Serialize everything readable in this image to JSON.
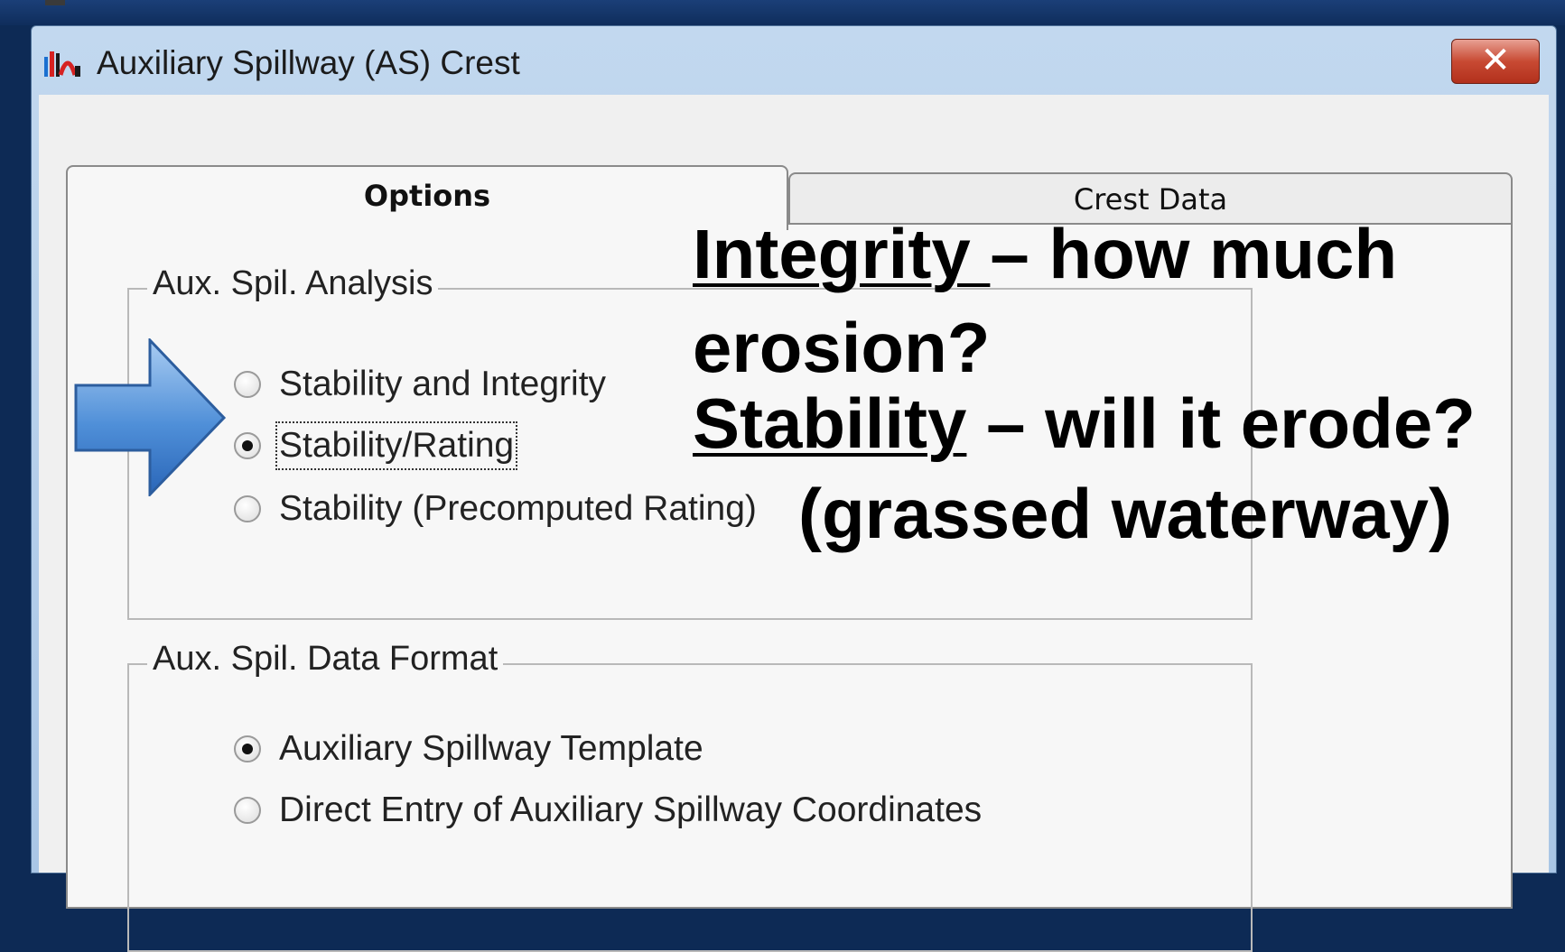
{
  "window": {
    "title": "Auxiliary Spillway (AS) Crest",
    "close_glyph": "✕"
  },
  "tabs": [
    {
      "label": "Options",
      "active": true
    },
    {
      "label": "Crest Data",
      "active": false
    }
  ],
  "analysis_group": {
    "legend": "Aux. Spil. Analysis",
    "options": [
      {
        "label": "Stability and Integrity",
        "checked": false
      },
      {
        "label": "Stability/Rating",
        "checked": true
      },
      {
        "label": "Stability (Precomputed Rating)",
        "checked": false
      }
    ]
  },
  "format_group": {
    "legend": "Aux. Spil. Data Format",
    "options": [
      {
        "label": "Auxiliary Spillway Template",
        "checked": true
      },
      {
        "label": "Direct Entry of Auxiliary Spillway Coordinates",
        "checked": false
      }
    ]
  },
  "annotation": {
    "integrity_term": "Integrity ",
    "integrity_text": "– how much",
    "integrity_text2": "erosion?",
    "stability_term": "Stability",
    "stability_text": " – will it erode?",
    "stability_text2": "(grassed waterway)"
  },
  "icons": {
    "app": "spillway-app-icon",
    "pointer": "blue-right-arrow-icon",
    "close": "close-icon"
  }
}
